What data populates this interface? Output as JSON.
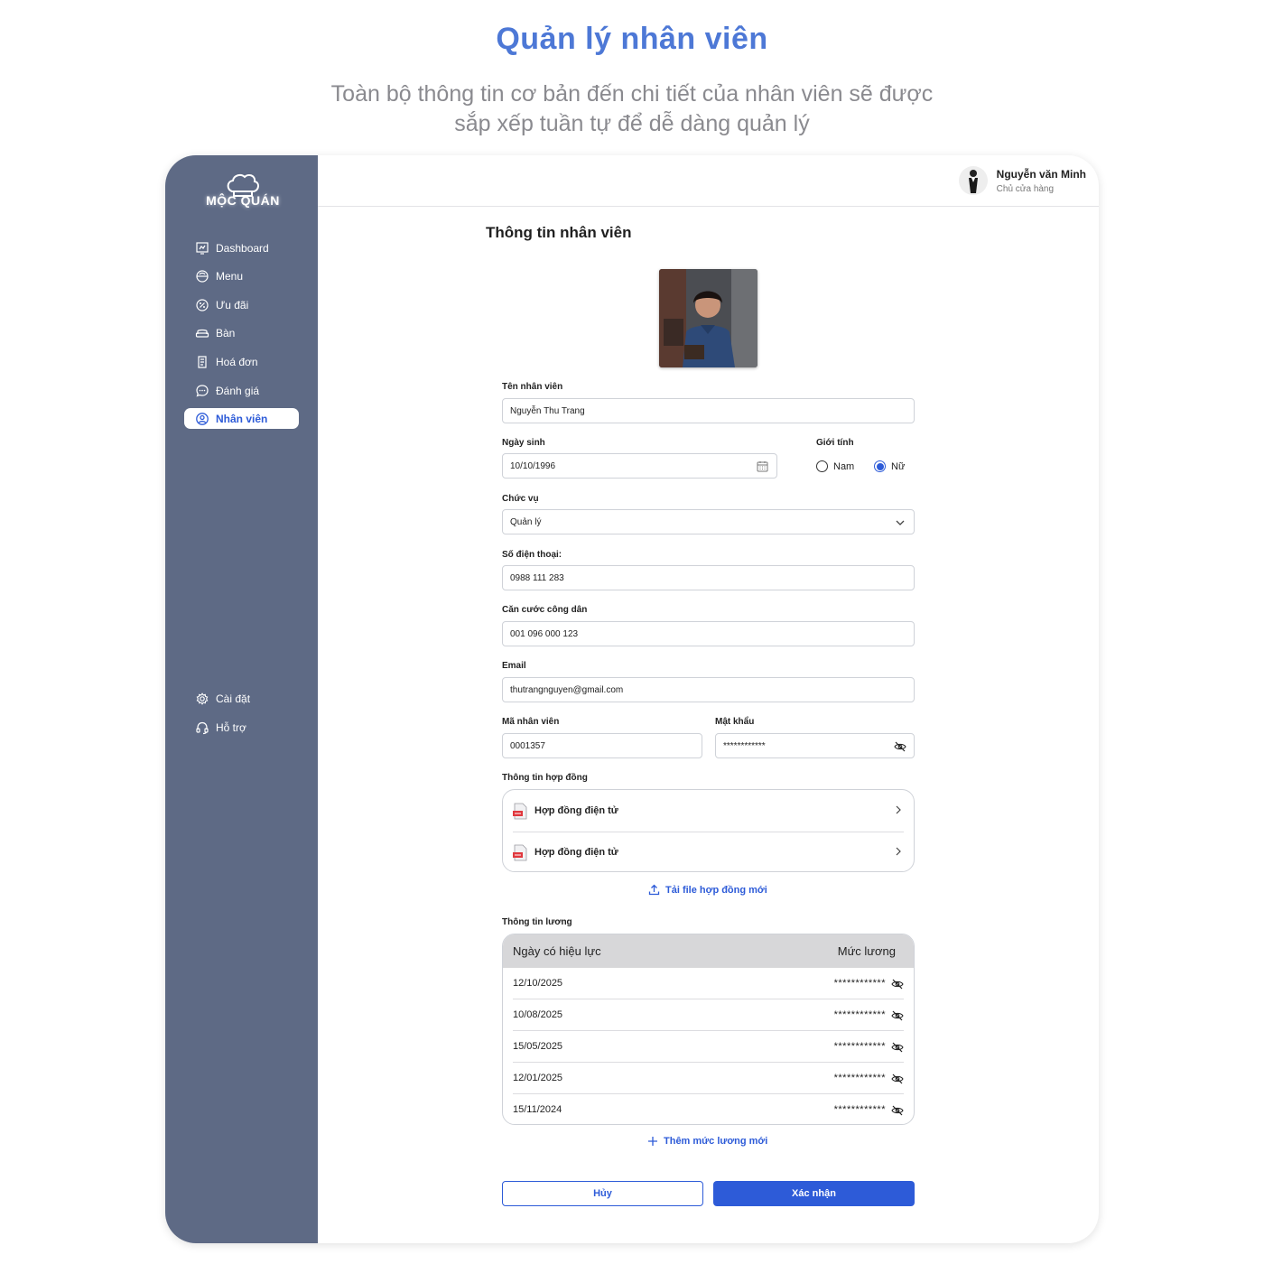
{
  "hero": {
    "title": "Quản lý nhân viên",
    "subtitle_line1": "Toàn bộ thông tin cơ bản đến chi tiết của nhân viên sẽ được",
    "subtitle_line2": "sắp xếp tuần tự để dễ dàng quản lý"
  },
  "brand": {
    "name": "MỘC QUÁN"
  },
  "sidebar": {
    "items": [
      {
        "label": "Dashboard",
        "icon": "chart-icon"
      },
      {
        "label": "Menu",
        "icon": "bowl-icon"
      },
      {
        "label": "Ưu đãi",
        "icon": "discount-icon"
      },
      {
        "label": "Bàn",
        "icon": "sofa-icon"
      },
      {
        "label": "Hoá đơn",
        "icon": "receipt-icon"
      },
      {
        "label": "Đánh giá",
        "icon": "chat-icon"
      },
      {
        "label": "Nhân viên",
        "icon": "user-circle-icon",
        "active": true
      }
    ],
    "bottom_items": [
      {
        "label": "Cài đặt",
        "icon": "gear-icon"
      },
      {
        "label": "Hỗ trợ",
        "icon": "headset-icon"
      }
    ]
  },
  "user": {
    "name": "Nguyễn văn Minh",
    "role": "Chủ cửa hàng"
  },
  "form": {
    "title": "Thông tin nhân viên",
    "name_label": "Tên nhân viên",
    "name_value": "Nguyễn Thu Trang",
    "dob_label": "Ngày sinh",
    "dob_value": "10/10/1996",
    "gender_label": "Giới tính",
    "gender_male": "Nam",
    "gender_female": "Nữ",
    "gender_selected": "Nữ",
    "position_label": "Chức vụ",
    "position_value": "Quản lý",
    "phone_label": "Số điện thoại:",
    "phone_value": "0988 111 283",
    "id_label": "Căn cước công dân",
    "id_value": "001 096 000 123",
    "email_label": "Email",
    "email_value": "thutrangnguyen@gmail.com",
    "code_label": "Mã nhân viên",
    "code_value": "0001357",
    "password_label": "Mật khẩu",
    "password_value": "************"
  },
  "contracts": {
    "label": "Thông tin hợp đồng",
    "items": [
      {
        "title": "Hợp đồng điện tử"
      },
      {
        "title": "Hợp đồng điện tử"
      }
    ],
    "upload_label": "Tải file hợp đồng mới"
  },
  "salary": {
    "label": "Thông tin lương",
    "col_date": "Ngày có hiệu lực",
    "col_amount": "Mức lương",
    "rows": [
      {
        "date": "12/10/2025",
        "amount": "************"
      },
      {
        "date": "10/08/2025",
        "amount": "************"
      },
      {
        "date": "15/05/2025",
        "amount": "************"
      },
      {
        "date": "12/01/2025",
        "amount": "************"
      },
      {
        "date": "15/11/2024",
        "amount": "************"
      }
    ],
    "add_label": "Thêm mức lương mới"
  },
  "actions": {
    "cancel": "Hủy",
    "confirm": "Xác nhận"
  },
  "colors": {
    "accent": "#2d5bd8",
    "sidebar": "#5e6a85",
    "hero_title": "#4d78d6"
  }
}
